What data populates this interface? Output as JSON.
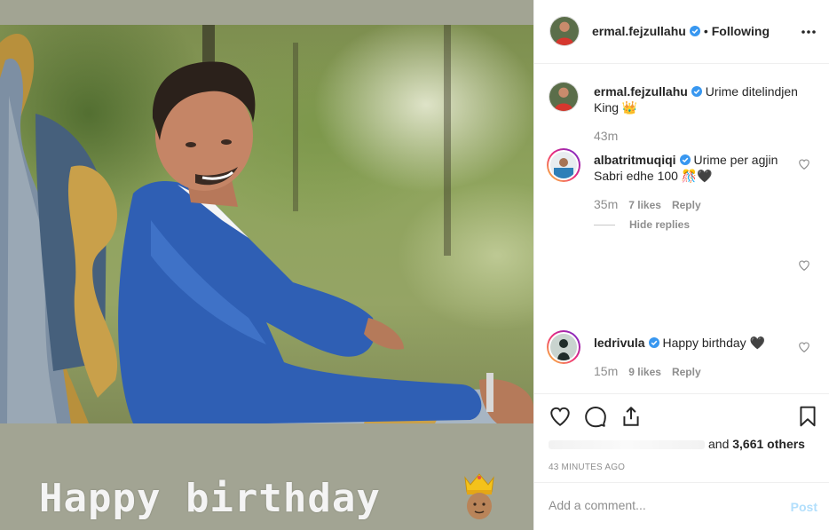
{
  "media": {
    "caption_text": "Happy birthday",
    "caption_emoji": "prince-with-crown-emoji"
  },
  "header": {
    "username": "ermal.fejzullahu",
    "verified": true,
    "separator": "•",
    "follow_status": "Following",
    "more_icon": "more-horizontal-icon"
  },
  "caption": {
    "username": "ermal.fejzullahu",
    "text": "Urime ditelindjen King 👑",
    "time": "43m"
  },
  "comments": [
    {
      "username": "albatritmuqiqi",
      "text": "Urime per agjin Sabri edhe 100 🎊🖤",
      "time": "35m",
      "likes": "7 likes",
      "reply": "Reply"
    },
    {
      "username": "ledrivula",
      "text": "Happy birthday 🖤",
      "time": "15m",
      "likes": "9 likes",
      "reply": "Reply"
    }
  ],
  "hide_replies": "Hide replies",
  "actions": {
    "icons": [
      "heart-icon",
      "comment-icon",
      "share-icon",
      "bookmark-icon"
    ]
  },
  "likes_summary": {
    "tail": "and",
    "count": "3,661 others"
  },
  "timestamp": "43 MINUTES AGO",
  "add_comment": {
    "placeholder": "Add a comment...",
    "post_label": "Post"
  },
  "colors": {
    "verified_blue": "#3897f0",
    "post_disabled": "#b2dffc",
    "muted": "#8e8e8e"
  }
}
